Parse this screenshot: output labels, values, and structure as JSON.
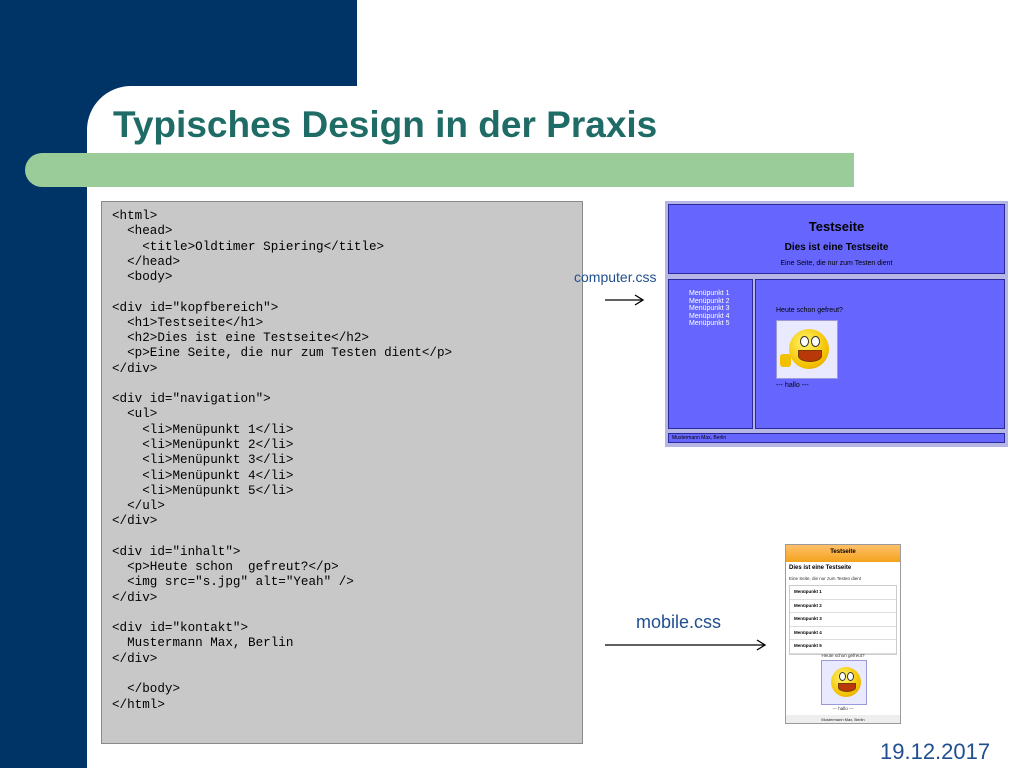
{
  "slide": {
    "title": "Typisches Design in der Praxis",
    "date": "19.12.2017",
    "colors": {
      "navy": "#003366",
      "green_bar": "#99cc99",
      "title": "#1f6b66",
      "label": "#1f4f8f"
    }
  },
  "code_listing": [
    "<html>",
    "  <head>",
    "    <title>Oldtimer Spiering</title>",
    "  </head>",
    "  <body>",
    "",
    "<div id=\"kopfbereich\">",
    "  <h1>Testseite</h1>",
    "  <h2>Dies ist eine Testseite</h2>",
    "  <p>Eine Seite, die nur zum Testen dient</p>",
    "</div>",
    "",
    "<div id=\"navigation\">",
    "  <ul>",
    "    <li>Menüpunkt 1</li>",
    "    <li>Menüpunkt 2</li>",
    "    <li>Menüpunkt 3</li>",
    "    <li>Menüpunkt 4</li>",
    "    <li>Menüpunkt 5</li>",
    "  </ul>",
    "</div>",
    "",
    "<div id=\"inhalt\">",
    "  <p>Heute schon  gefreut?</p>",
    "  <img src=\"s.jpg\" alt=\"Yeah\" />",
    "</div>",
    "",
    "<div id=\"kontakt\">",
    "  Mustermann Max, Berlin",
    "</div>",
    "",
    "  </body>",
    "</html>"
  ],
  "labels": {
    "computer": "computer.css",
    "mobile": "mobile.css"
  },
  "computer_preview": {
    "h1": "Testseite",
    "h2": "Dies ist eine Testseite",
    "p": "Eine Seite, die nur zum Testen dient",
    "menu": [
      "Menüpunkt 1",
      "Menüpunkt 2",
      "Menüpunkt 3",
      "Menüpunkt 4",
      "Menüpunkt 5"
    ],
    "question": "Heute schon gefreut?",
    "hallo": "--- hallo ---",
    "footer": "Mustermann Max, Berlin",
    "bg": "#6666ff"
  },
  "mobile_preview": {
    "h1": "Testseite",
    "h2": "Dies ist eine Testseite",
    "p": "Eine Seite, die nur zum Testen dient",
    "menu": [
      "Menüpunkt 1",
      "Menüpunkt 2",
      "Menüpunkt 3",
      "Menüpunkt 4",
      "Menüpunkt 5"
    ],
    "question": "Heute schon gefreut?",
    "hallo": "--- hallo ---",
    "footer": "Mustermann Max, Berlin",
    "header_color": "#f3a31c"
  }
}
